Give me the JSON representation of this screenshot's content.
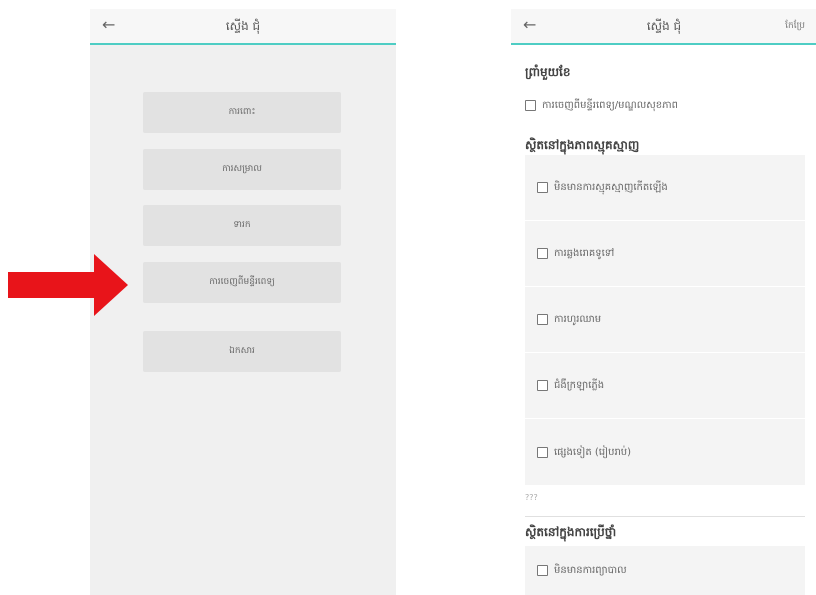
{
  "left_screen": {
    "header": {
      "back_icon": "←",
      "title": "ស្ទើង ជុំ"
    },
    "menu": [
      {
        "label": "ការពោះ"
      },
      {
        "label": "ការសម្រាល"
      },
      {
        "label": "ទារក"
      },
      {
        "label": "ការចេញពីមន្ទីរពេទ្យ"
      },
      {
        "label": "ឯកសារ"
      }
    ],
    "arrow_color": "#e8141a"
  },
  "right_screen": {
    "header": {
      "back_icon": "←",
      "title": "ស្ទើង ជុំ",
      "action": "កែប្រែ"
    },
    "section1": {
      "title": "ព្រាំមួយខែ",
      "option": "ការចេញពីមន្ទីរពេទ្យ/មណ្ឌលសុខភាព"
    },
    "section2": {
      "title": "ស្ថិតនៅក្នុងភាពស្មុគស្មាញ",
      "options": [
        "មិនមានការស្មុគស្មាញកើតឡើង",
        "ការឆ្លងរោគទូទៅ",
        "ការហូរឈាម",
        "ជំងឺក្រឡាភ្លើង",
        "ផ្សេងទៀត (រៀបរាប់)"
      ],
      "hint": "???"
    },
    "section3": {
      "title": "ស្ថិតនៅក្នុងការប្រើថ្នាំ",
      "options": [
        "មិនមានការព្យាបាល"
      ]
    }
  },
  "colors": {
    "accent": "#4ecdc4",
    "arrow": "#e8141a",
    "button": "#e2e2e2"
  }
}
